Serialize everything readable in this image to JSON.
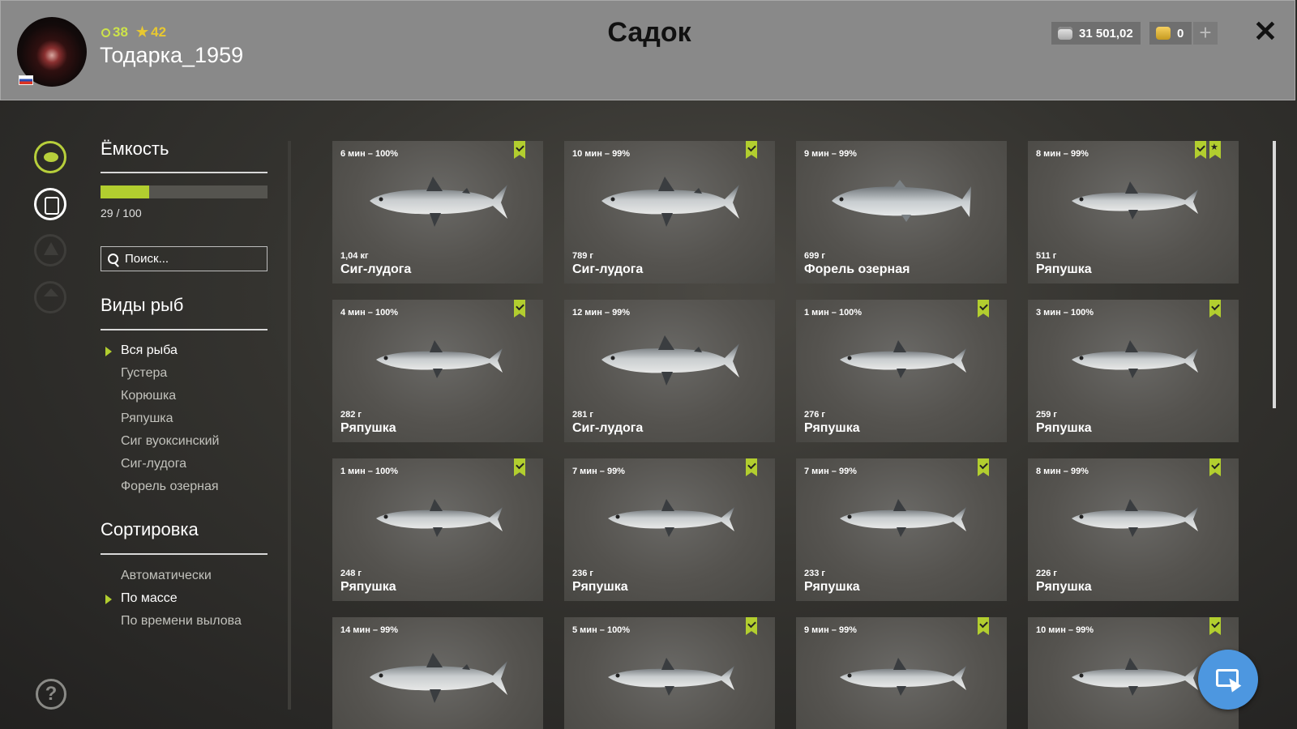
{
  "header": {
    "title": "Садок",
    "username": "Тодарка_1959",
    "level": "38",
    "rank": "42",
    "silver": "31 501,02",
    "gold": "0"
  },
  "capacity": {
    "title": "Ёмкость",
    "current": 29,
    "max": 100,
    "label": "29 / 100",
    "fill_fraction": 0.29
  },
  "search": {
    "placeholder": "Поиск..."
  },
  "species": {
    "title": "Виды рыб",
    "items": [
      "Вся рыба",
      "Густера",
      "Корюшка",
      "Ряпушка",
      "Сиг вуоксинский",
      "Сиг-лудога",
      "Форель озерная"
    ],
    "active_index": 0
  },
  "sorting": {
    "title": "Сортировка",
    "items": [
      "Автоматически",
      "По массе",
      "По времени вылова"
    ],
    "active_index": 1
  },
  "colors": {
    "accent": "#b2ce2f",
    "fab": "#4d97e0",
    "header": "#898989"
  },
  "fish_cards": [
    {
      "time": "6 мин – 100%",
      "weight": "1,04 кг",
      "name": "Сиг-лудога",
      "bookmark": true,
      "starred": false,
      "kind": "whitefish"
    },
    {
      "time": "10 мин – 99%",
      "weight": "789 г",
      "name": "Сиг-лудога",
      "bookmark": true,
      "starred": false,
      "kind": "whitefish"
    },
    {
      "time": "9 мин – 99%",
      "weight": "699 г",
      "name": "Форель озерная",
      "bookmark": false,
      "starred": false,
      "kind": "trout"
    },
    {
      "time": "8 мин – 99%",
      "weight": "511 г",
      "name": "Ряпушка",
      "bookmark": true,
      "starred": true,
      "kind": "vendace"
    },
    {
      "time": "4 мин – 100%",
      "weight": "282 г",
      "name": "Ряпушка",
      "bookmark": true,
      "starred": false,
      "kind": "vendace"
    },
    {
      "time": "12 мин – 99%",
      "weight": "281 г",
      "name": "Сиг-лудога",
      "bookmark": false,
      "starred": false,
      "kind": "whitefish"
    },
    {
      "time": "1 мин – 100%",
      "weight": "276 г",
      "name": "Ряпушка",
      "bookmark": true,
      "starred": false,
      "kind": "vendace"
    },
    {
      "time": "3 мин – 100%",
      "weight": "259 г",
      "name": "Ряпушка",
      "bookmark": true,
      "starred": false,
      "kind": "vendace"
    },
    {
      "time": "1 мин – 100%",
      "weight": "248 г",
      "name": "Ряпушка",
      "bookmark": true,
      "starred": false,
      "kind": "vendace"
    },
    {
      "time": "7 мин – 99%",
      "weight": "236 г",
      "name": "Ряпушка",
      "bookmark": true,
      "starred": false,
      "kind": "vendace"
    },
    {
      "time": "7 мин – 99%",
      "weight": "233 г",
      "name": "Ряпушка",
      "bookmark": true,
      "starred": false,
      "kind": "vendace"
    },
    {
      "time": "8 мин – 99%",
      "weight": "226 г",
      "name": "Ряпушка",
      "bookmark": true,
      "starred": false,
      "kind": "vendace"
    },
    {
      "time": "14 мин – 99%",
      "weight": "",
      "name": "",
      "bookmark": false,
      "starred": false,
      "kind": "whitefish"
    },
    {
      "time": "5 мин – 100%",
      "weight": "",
      "name": "",
      "bookmark": true,
      "starred": false,
      "kind": "vendace"
    },
    {
      "time": "9 мин – 99%",
      "weight": "",
      "name": "",
      "bookmark": true,
      "starred": false,
      "kind": "vendace"
    },
    {
      "time": "10 мин – 99%",
      "weight": "",
      "name": "",
      "bookmark": true,
      "starred": false,
      "kind": "vendace"
    }
  ],
  "icons": {
    "rail": [
      "fish-icon",
      "keepnet-icon",
      "tent-icon",
      "home-icon"
    ],
    "help": "help-icon",
    "close": "close-icon",
    "fab": "cursor-select-icon"
  }
}
